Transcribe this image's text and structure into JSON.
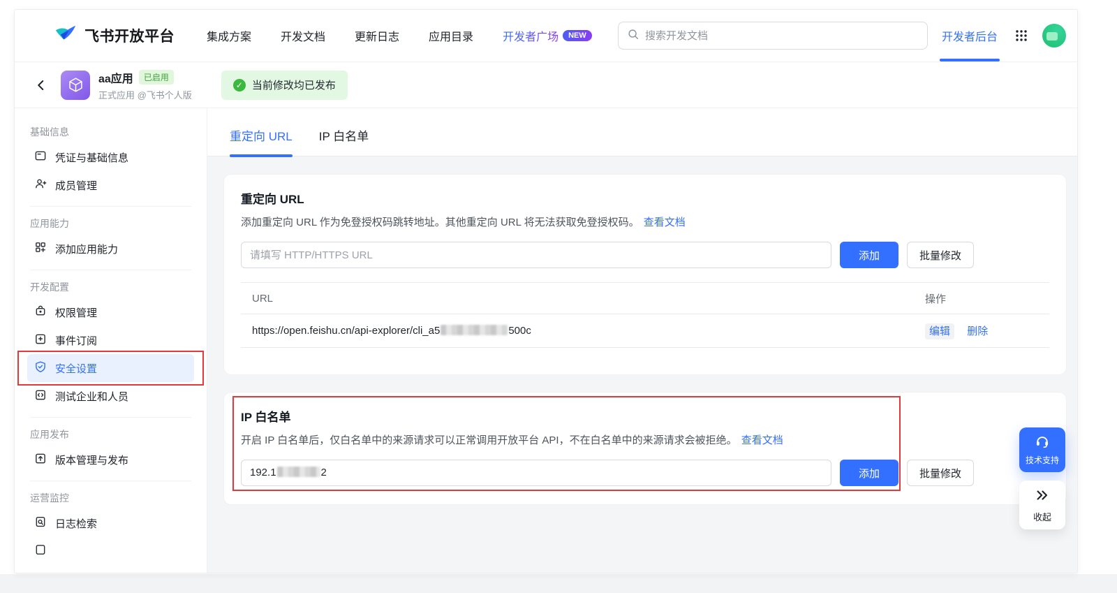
{
  "nav": {
    "brand": "飞书开放平台",
    "items": [
      {
        "label": "集成方案"
      },
      {
        "label": "开发文档"
      },
      {
        "label": "更新日志"
      },
      {
        "label": "应用目录"
      },
      {
        "label": "开发者广场",
        "badge": "NEW"
      }
    ],
    "search_placeholder": "搜索开发文档",
    "console_link": "开发者后台"
  },
  "app_header": {
    "name": "aa应用",
    "status_badge": "已启用",
    "subtitle": "正式应用 @飞书个人版",
    "publish_banner": "当前修改均已发布"
  },
  "sidebar": {
    "sections": [
      {
        "title": "基础信息",
        "items": [
          {
            "label": "凭证与基础信息",
            "icon": "credential-icon"
          },
          {
            "label": "成员管理",
            "icon": "member-icon"
          }
        ]
      },
      {
        "title": "应用能力",
        "items": [
          {
            "label": "添加应用能力",
            "icon": "add-capability-icon"
          }
        ]
      },
      {
        "title": "开发配置",
        "items": [
          {
            "label": "权限管理",
            "icon": "permission-icon"
          },
          {
            "label": "事件订阅",
            "icon": "event-subscribe-icon"
          },
          {
            "label": "安全设置",
            "icon": "security-shield-icon",
            "active": true
          },
          {
            "label": "测试企业和人员",
            "icon": "test-code-icon"
          }
        ]
      },
      {
        "title": "应用发布",
        "items": [
          {
            "label": "版本管理与发布",
            "icon": "release-icon"
          }
        ]
      },
      {
        "title": "运营监控",
        "items": [
          {
            "label": "日志检索",
            "icon": "log-search-icon"
          }
        ]
      }
    ]
  },
  "main": {
    "tabs": [
      {
        "label": "重定向 URL",
        "active": true
      },
      {
        "label": "IP 白名单",
        "active": false
      }
    ],
    "redirect_card": {
      "title": "重定向 URL",
      "description": "添加重定向 URL 作为免登授权码跳转地址。其他重定向 URL 将无法获取免登授权码。",
      "doc_link": "查看文档",
      "input_placeholder": "请填写 HTTP/HTTPS URL",
      "add_button": "添加",
      "batch_button": "批量修改",
      "table": {
        "columns": [
          "URL",
          "操作"
        ],
        "rows": [
          {
            "url_prefix": "https://open.feishu.cn/api-explorer/cli_a5",
            "url_suffix": "500c",
            "url_redacted_middle": true,
            "actions": [
              "编辑",
              "删除"
            ]
          }
        ]
      }
    },
    "ip_card": {
      "title": "IP 白名单",
      "description": "开启 IP 白名单后，仅白名单中的来源请求可以正常调用开放平台 API，不在白名单中的来源请求会被拒绝。",
      "doc_link": "查看文档",
      "input_value_prefix": "192.1",
      "input_value_suffix": "2",
      "input_redacted_middle": true,
      "add_button": "添加",
      "batch_button": "批量修改"
    }
  },
  "floating": {
    "support_button": "技术支持",
    "collapse_button": "收起"
  },
  "colors": {
    "accent_blue": "#3370ff",
    "success_green": "#3cb83c",
    "success_bg": "#e3f8e2",
    "badge_purple_gradient": "#4d5df4-#8a3cf5",
    "app_icon_purple": "#8157ea",
    "annotation_red": "#e5383b",
    "content_bg": "#f4f5f7"
  }
}
